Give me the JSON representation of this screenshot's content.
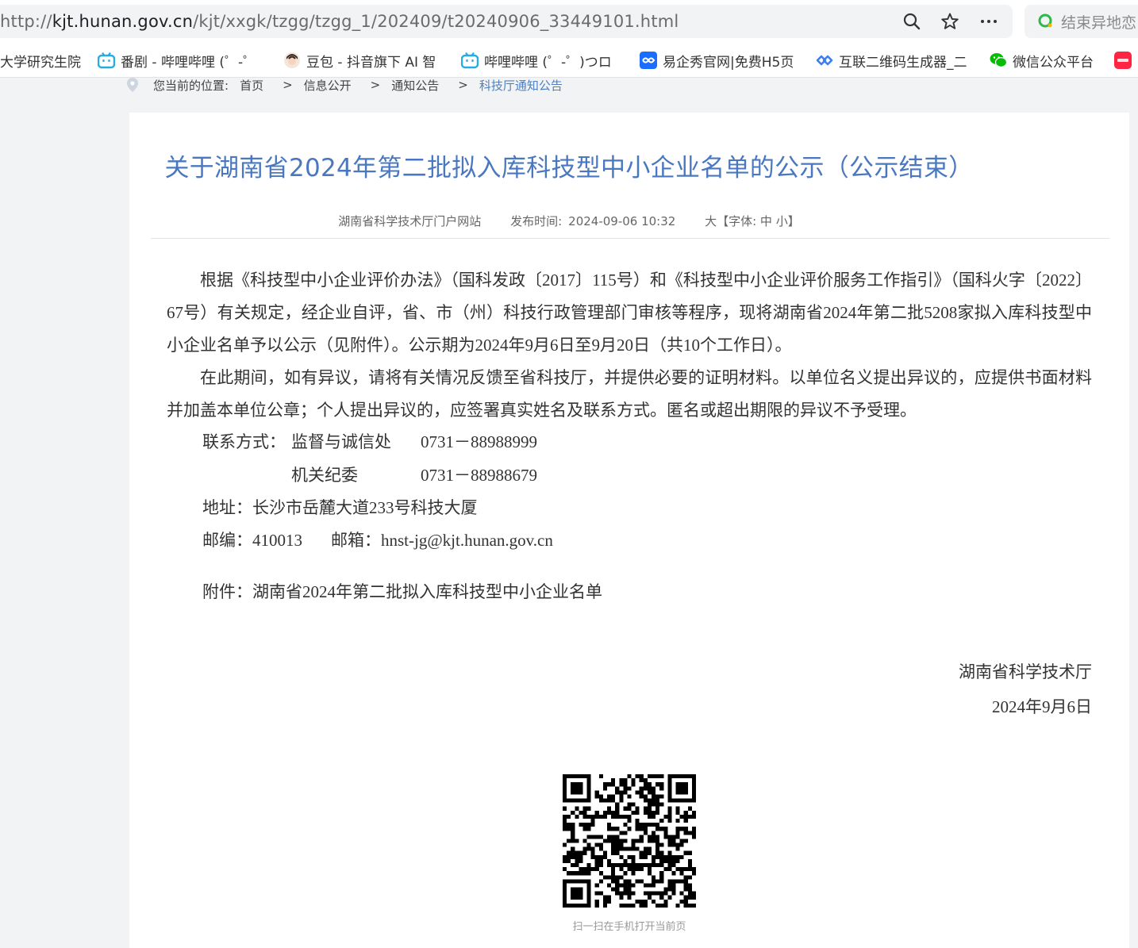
{
  "browser": {
    "url_prefix": "http://",
    "url_domain": "kjt.hunan.gov.cn",
    "url_path": "/kjt/xxgk/tzgg/tzgg_1/202409/t20240906_33449101.html",
    "side_search_text": "结束异地恋",
    "bookmarks": [
      {
        "label": "大学研究生院"
      },
      {
        "label": "番剧 - 哔哩哔哩 (゜-゜"
      },
      {
        "label": "豆包 - 抖音旗下 AI 智"
      },
      {
        "label": "哔哩哔哩 (゜-゜)つロ"
      },
      {
        "label": "易企秀官网|免费H5页"
      },
      {
        "label": "互联二维码生成器_二"
      },
      {
        "label": "微信公众平台"
      }
    ],
    "colors": {
      "bilibili": "#23ade5",
      "wechat": "#09bb07",
      "yiqixiu": "#1a6dff",
      "accent": "#4a78c0"
    }
  },
  "breadcrumb": {
    "prefix": "您当前的位置:",
    "items": [
      "首页",
      "信息公开",
      "通知公告",
      "科技厅通知公告"
    ],
    "separator": ">"
  },
  "article": {
    "title": "关于湖南省2024年第二批拟入库科技型中小企业名单的公示（公示结束）",
    "source": "湖南省科学技术厅门户网站",
    "publish_label": "发布时间:",
    "publish_time": "2024-09-06 10:32",
    "font_size_controls": "大【字体: 中 小】",
    "paragraphs": [
      "根据《科技型中小企业评价办法》（国科发政〔2017〕115号）和《科技型中小企业评价服务工作指引》（国科火字〔2022〕67号）有关规定，经企业自评，省、市（州）科技行政管理部门审核等程序，现将湖南省2024年第二批5208家拟入库科技型中小企业名单予以公示（见附件）。公示期为2024年9月6日至9月20日（共10个工作日）。",
      "在此期间，如有异议，请将有关情况反馈至省科技厅，并提供必要的证明材料。以单位名义提出异议的，应提供书面材料并加盖本单位公章；个人提出异议的，应签署真实姓名及联系方式。匿名或超出期限的异议不予受理。"
    ],
    "contact_label": "联系方式：",
    "contact1_dept": "监督与诚信处",
    "contact1_phone": "0731－88988999",
    "contact2_dept": "机关纪委",
    "contact2_phone": "0731－88988679",
    "address": "地址：长沙市岳麓大道233号科技大厦",
    "postcode": "邮编：410013",
    "email": "邮箱：hnst-jg@kjt.hunan.gov.cn",
    "attachment_label": "附件：",
    "attachment_link": "湖南省2024年第二批拟入库科技型中小企业名单",
    "signature_org": "湖南省科学技术厅",
    "signature_date": "2024年9月6日",
    "qr_caption": "扫一扫在手机打开当前页"
  }
}
